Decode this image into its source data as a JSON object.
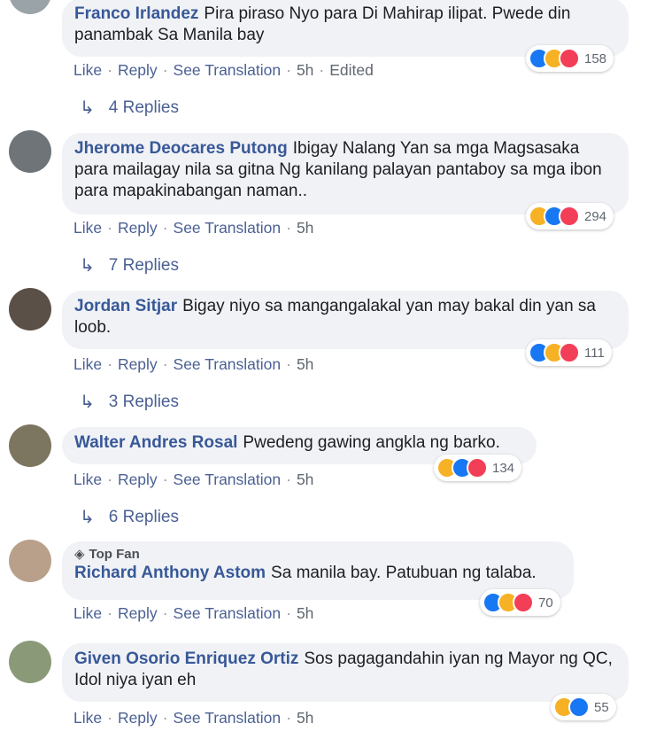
{
  "actions": {
    "like": "Like",
    "reply": "Reply",
    "see_translation": "See Translation",
    "dot": "·"
  },
  "comments": [
    {
      "author": "Franco Irlandez",
      "text": "Pira piraso Nyo para Di Mahirap ilipat. Pwede din panambak Sa Manila bay",
      "time": "5h",
      "edited": "Edited",
      "reaction_count": "158",
      "replies": "4 Replies",
      "reactions": [
        "like-icon",
        "haha-icon",
        "love-icon"
      ]
    },
    {
      "author": "Jherome Deocares Putong",
      "text": "Ibigay Nalang Yan sa mga Magsasaka para mailagay nila sa gitna Ng kanilang palayan pantaboy sa mga ibon para mapakinabangan naman..",
      "time": "5h",
      "reaction_count": "294",
      "replies": "7 Replies",
      "reactions": [
        "haha-icon",
        "like-icon",
        "love-icon"
      ]
    },
    {
      "author": "Jordan Sitjar",
      "text": "Bigay niyo sa mangangalakal yan may bakal din yan sa loob.",
      "time": "5h",
      "reaction_count": "111",
      "replies": "3 Replies",
      "reactions": [
        "like-icon",
        "haha-icon",
        "love-icon"
      ]
    },
    {
      "author": "Walter Andres Rosal",
      "text": "Pwedeng gawing angkla ng barko.",
      "time": "5h",
      "reaction_count": "134",
      "replies": "6 Replies",
      "reactions": [
        "haha-icon",
        "like-icon",
        "love-icon"
      ]
    },
    {
      "author": "Richard Anthony Astom",
      "badge": "Top Fan",
      "text": "Sa manila bay. Patubuan ng talaba.",
      "time": "5h",
      "reaction_count": "70",
      "reactions": [
        "like-icon",
        "haha-icon",
        "love-icon"
      ]
    },
    {
      "author": "Given Osorio Enriquez Ortiz",
      "text": "Sos pagagandahin iyan ng Mayor ng QC, Idol niya iyan eh",
      "time": "5h",
      "reaction_count": "55",
      "reactions": [
        "haha-icon",
        "like-icon"
      ]
    }
  ],
  "colors": {
    "author": "#385898",
    "bubble": "#f0f2f5",
    "like": "#1877f2",
    "haha": "#f7b125",
    "love": "#f33e58",
    "link": "#4b6094"
  }
}
